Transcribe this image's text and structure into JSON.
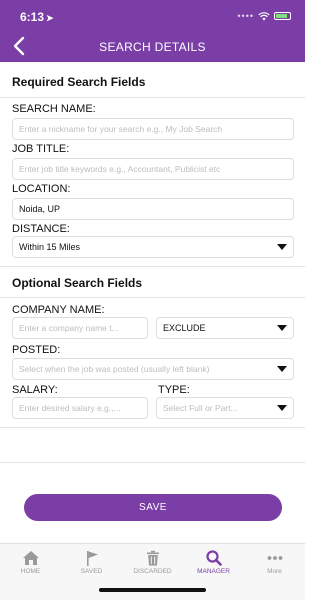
{
  "status_bar": {
    "time": "6:13"
  },
  "header": {
    "title": "SEARCH DETAILS"
  },
  "required": {
    "title": "Required Search Fields",
    "search_name": {
      "label": "SEARCH NAME:",
      "placeholder": "Enter a nickname for your search e.g., My Job Search"
    },
    "job_title": {
      "label": "JOB TITLE:",
      "placeholder": "Enter job title keywords e.g., Accountant, Publicist etc"
    },
    "location": {
      "label": "LOCATION:",
      "value": "Noida, UP"
    },
    "distance": {
      "label": "DISTANCE:",
      "value": "Within 15 Miles"
    }
  },
  "optional": {
    "title": "Optional Search Fields",
    "company": {
      "label": "COMPANY NAME:",
      "placeholder": "Enter a company name t...",
      "mode": "EXCLUDE"
    },
    "posted": {
      "label": "POSTED:",
      "placeholder": "Select when the job was posted (usually left blank)"
    },
    "salary": {
      "label": "SALARY:",
      "placeholder": "Enter desired salary e.g.,..."
    },
    "type": {
      "label": "TYPE:",
      "placeholder": "Select Full or Part..."
    }
  },
  "save_label": "SAVE",
  "tabs": [
    {
      "label": "HOME",
      "icon": "home-icon",
      "active": false
    },
    {
      "label": "SAVED",
      "icon": "flag-icon",
      "active": false
    },
    {
      "label": "DISCARDED",
      "icon": "trash-icon",
      "active": false
    },
    {
      "label": "MANAGER",
      "icon": "search-icon",
      "active": true
    },
    {
      "label": "More",
      "icon": "more-icon",
      "active": false
    }
  ],
  "colors": {
    "brand": "#7a3ea6",
    "inactive_tab": "#9a9a9a"
  }
}
